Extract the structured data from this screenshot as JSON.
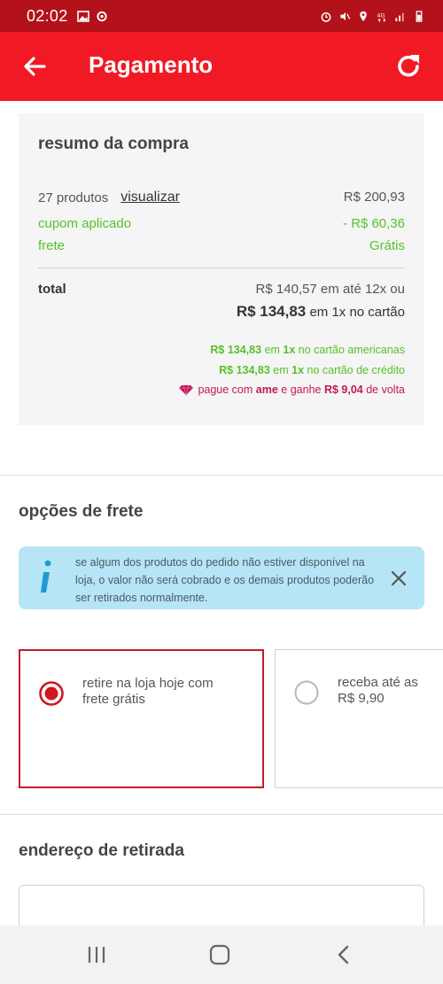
{
  "status_bar": {
    "time": "02:02",
    "icons_left": [
      "image-icon",
      "sync-icon"
    ],
    "icons_right": [
      "alarm-icon",
      "mute-icon",
      "location-icon",
      "network-4g-icon",
      "signal-icon",
      "battery-icon"
    ]
  },
  "app_bar": {
    "title": "Pagamento",
    "back_icon": "arrow-left-icon",
    "refresh_icon": "refresh-icon"
  },
  "summary": {
    "title": "resumo da compra",
    "products_label": "27 produtos",
    "view_link": "visualizar",
    "products_value": "R$ 200,93",
    "coupon_label": "cupom aplicado",
    "coupon_value": "- R$ 60,36",
    "shipping_label": "frete",
    "shipping_value": "Grátis",
    "total_label": "total",
    "installments_text": "R$ 140,57 em até 12x ou",
    "total_value": "R$ 134,83",
    "total_suffix": "em 1x no cartão",
    "promo_americanas": {
      "value": "R$ 134,83",
      "mid": " em ",
      "times": "1x",
      "suffix": " no cartão americanas"
    },
    "promo_credit": {
      "value": "R$ 134,83",
      "mid": " em ",
      "times": "1x",
      "suffix": " no cartão de crédito"
    },
    "ame": {
      "prefix": "pague com ",
      "brand": "ame",
      "mid": " e ganhe ",
      "value": "R$ 9,04",
      "suffix": " de volta"
    }
  },
  "shipping": {
    "title": "opções de frete",
    "info_text": "se algum dos produtos do pedido não estiver disponível na loja, o valor não será cobrado e os demais produtos poderão ser retirados normalmente.",
    "options": [
      {
        "label": "retire na loja hoje com frete grátis",
        "selected": true
      },
      {
        "label": "receba até as",
        "price": "R$ 9,90",
        "selected": false
      }
    ]
  },
  "pickup": {
    "title": "endereço de retirada"
  },
  "colors": {
    "brand_red": "#f11a24",
    "status_red": "#b3121a",
    "green": "#56c22a",
    "ame_pink": "#c2185b",
    "info_blue": "#b6e5f5"
  }
}
